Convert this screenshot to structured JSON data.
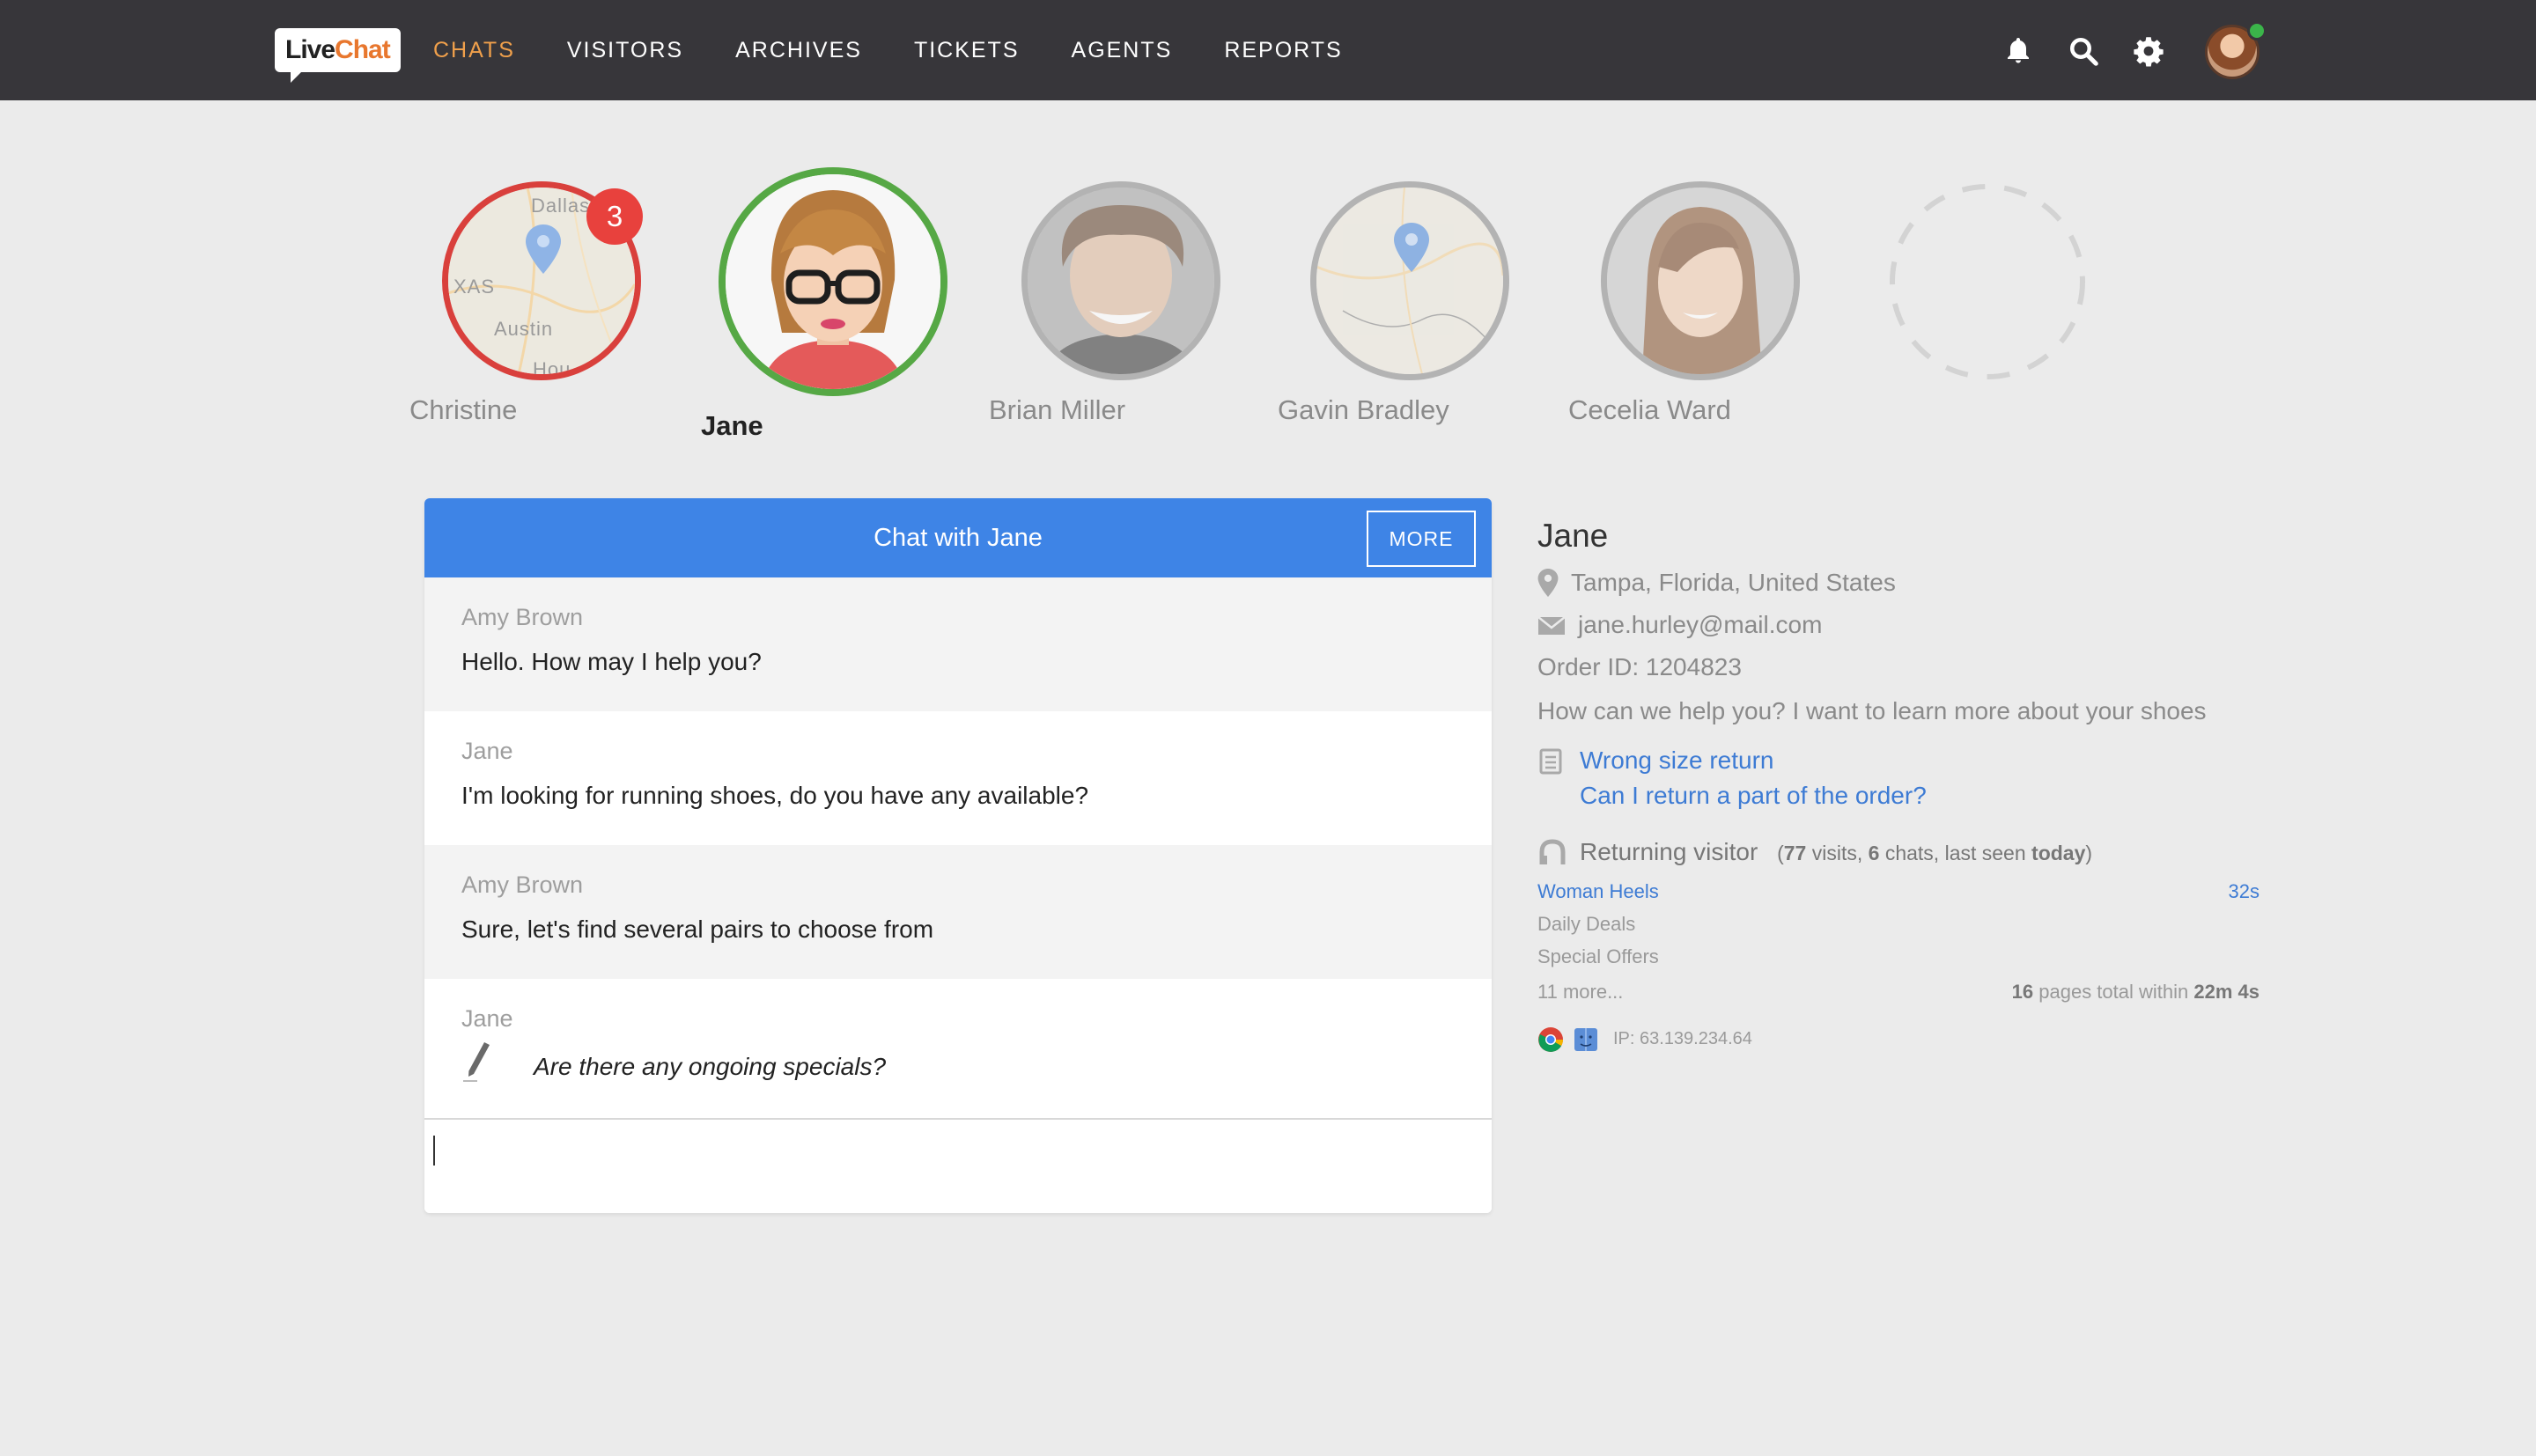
{
  "app": {
    "logo_live": "Live",
    "logo_chat": "Chat"
  },
  "nav": {
    "items": [
      {
        "label": "CHATS",
        "active": true
      },
      {
        "label": "VISITORS"
      },
      {
        "label": "ARCHIVES"
      },
      {
        "label": "TICKETS"
      },
      {
        "label": "AGENTS"
      },
      {
        "label": "REPORTS"
      }
    ],
    "icons": [
      "bell-icon",
      "search-icon",
      "gear-icon"
    ],
    "status_color": "#3bb54a"
  },
  "visitors": [
    {
      "name": "Christine",
      "badge": "3",
      "ring_color": "#d9403c",
      "map_labels": [
        "Dallas",
        "XAS",
        "Austin",
        "Hou"
      ]
    },
    {
      "name": "Jane",
      "active": true,
      "ring_color": "#56a845"
    },
    {
      "name": "Brian Miller",
      "ring_color": "#b3b3b3"
    },
    {
      "name": "Gavin Bradley",
      "ring_color": "#b3b3b3"
    },
    {
      "name": "Cecelia Ward",
      "ring_color": "#b3b3b3"
    }
  ],
  "chat": {
    "title": "Chat with Jane",
    "more_label": "MORE",
    "header_color": "#3e84e6",
    "messages": [
      {
        "author": "Amy Brown",
        "text": "Hello. How may I help you?"
      },
      {
        "author": "Jane",
        "text": "I'm looking for running shoes, do you have any available?"
      },
      {
        "author": "Amy Brown",
        "text": "Sure, let's find several pairs to choose from"
      },
      {
        "author": "Jane",
        "text": "Are there any ongoing specials?",
        "typing": true
      }
    ]
  },
  "info": {
    "name": "Jane",
    "location": "Tampa, Florida, United States",
    "email": "jane.hurley@mail.com",
    "order": "Order ID: 1204823",
    "question": "How can we help you? I want to learn more about your shoes",
    "articles": [
      "Wrong size return",
      "Can I return a part of the order?"
    ],
    "returning_label": "Returning visitor",
    "visits_num": "77",
    "visits_txt": " visits, ",
    "chats_num": "6",
    "chats_txt": " chats, last seen ",
    "last_seen": "today",
    "pages": [
      {
        "title": "Woman Heels",
        "time": "32s",
        "current": true
      },
      {
        "title": "Daily Deals"
      },
      {
        "title": "Special Offers"
      }
    ],
    "more_pages": "11 more...",
    "pages_count": "16",
    "pages_total_txt": " pages total within ",
    "pages_duration": "22m 4s",
    "ip": "IP:  63.139.234.64"
  }
}
